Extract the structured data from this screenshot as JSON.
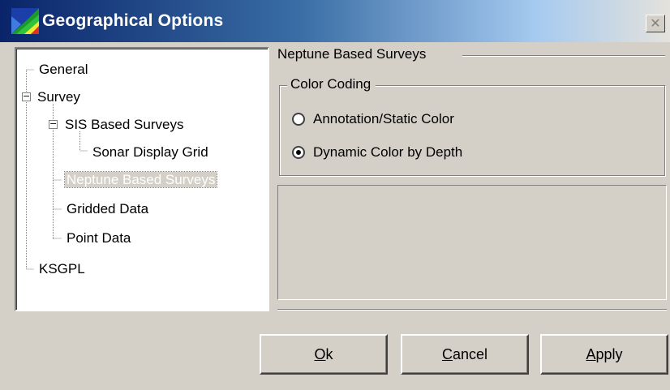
{
  "window": {
    "title": "Geographical Options",
    "close_label": "✕"
  },
  "tree": {
    "items": [
      {
        "label": "General",
        "level": 0
      },
      {
        "label": "Survey",
        "level": 0,
        "expander": "−"
      },
      {
        "label": "SIS Based Surveys",
        "level": 1,
        "expander": "−"
      },
      {
        "label": "Sonar Display Grid",
        "level": 2
      },
      {
        "label": "Neptune Based Surveys",
        "level": 1,
        "selected": true
      },
      {
        "label": "Gridded Data",
        "level": 1
      },
      {
        "label": "Point Data",
        "level": 1
      },
      {
        "label": "KSGPL",
        "level": 0
      }
    ]
  },
  "panel": {
    "title": "Neptune Based Surveys",
    "color_coding": {
      "title": "Color Coding",
      "options": [
        {
          "label": "Annotation/Static Color",
          "checked": false
        },
        {
          "label": "Dynamic Color by Depth",
          "checked": true
        }
      ]
    }
  },
  "buttons": {
    "ok": {
      "mnemonic": "O",
      "rest": "k"
    },
    "cancel": {
      "mnemonic": "C",
      "rest": "ancel"
    },
    "apply": {
      "mnemonic": "A",
      "rest": "pply"
    }
  }
}
